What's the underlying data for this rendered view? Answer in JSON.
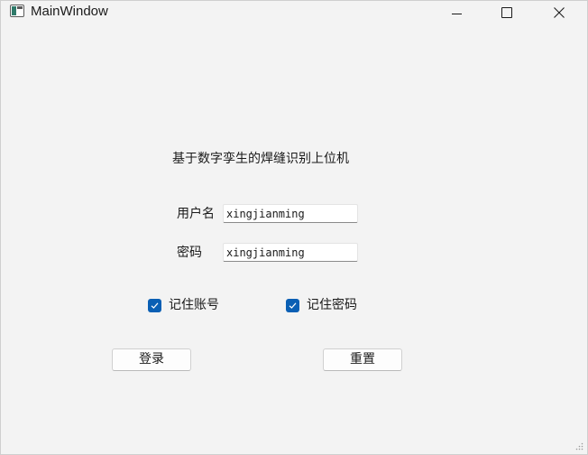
{
  "window": {
    "title": "MainWindow",
    "controls": {
      "minimize": "minimize-icon",
      "maximize": "maximize-icon",
      "close": "close-icon"
    }
  },
  "form": {
    "heading": "基于数字孪生的焊缝识别上位机",
    "username_label": "用户名",
    "username_value": "xingjianming",
    "password_label": "密码",
    "password_value": "xingjianming",
    "remember_account_label": "记住账号",
    "remember_account_checked": true,
    "remember_password_label": "记住密码",
    "remember_password_checked": true,
    "login_button": "登录",
    "reset_button": "重置"
  },
  "colors": {
    "accent": "#0a5fb4",
    "background": "#f3f3f3",
    "text": "#1a1a1a"
  }
}
